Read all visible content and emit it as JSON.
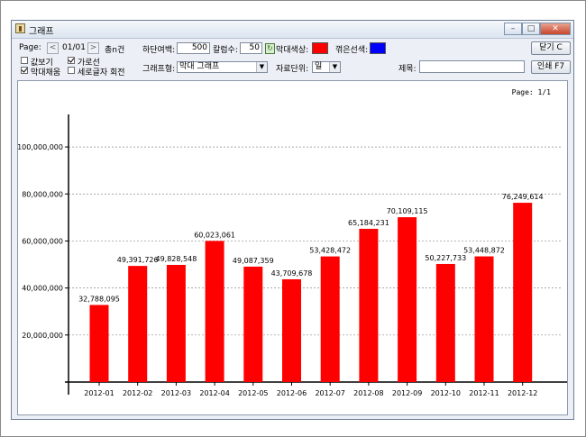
{
  "window": {
    "title": "그래프"
  },
  "toolbar": {
    "page_label": "Page:",
    "page_value": "01/01",
    "total_label": "총n건",
    "bottom_margin_label": "하단여백:",
    "bottom_margin_value": "500",
    "column_count_label": "칼럼수:",
    "column_count_value": "50",
    "bar_color_label": "막대색상:",
    "line_color_label": "꺾은선색:",
    "bar_color": "#ff0000",
    "line_color": "#0000ff",
    "close_label": "닫기 C",
    "print_label": "인쇄 F7",
    "checkbox_value": {
      "label": "값보기",
      "checked": false
    },
    "checkbox_gridline": {
      "label": "가로선",
      "checked": true
    },
    "checkbox_barfill": {
      "label": "막대채움",
      "checked": true
    },
    "checkbox_vertical_text": {
      "label": "세로글자 회전",
      "checked": false
    },
    "graph_type_label": "그래프형:",
    "graph_type_value": "막대 그래프",
    "data_unit_label": "자료단위:",
    "data_unit_value": "일",
    "title_label": "제목:",
    "title_value": ""
  },
  "chart_page": "Page: 1/1",
  "chart_data": {
    "type": "bar",
    "categories": [
      "2012-01",
      "2012-02",
      "2012-03",
      "2012-04",
      "2012-05",
      "2012-06",
      "2012-07",
      "2012-08",
      "2012-09",
      "2012-10",
      "2012-11",
      "2012-12"
    ],
    "values": [
      32788095,
      49391726,
      49828548,
      60023061,
      49087359,
      43709678,
      53428472,
      65184231,
      70109115,
      50227733,
      53448872,
      76249614
    ],
    "value_labels": [
      "32,788,095",
      "49,391,726",
      "49,828,548",
      "60,023,061",
      "49,087,359",
      "43,709,678",
      "53,428,472",
      "65,184,231",
      "70,109,115",
      "50,227,733",
      "53,448,872",
      "76,249,614"
    ],
    "yticks": [
      20000000,
      40000000,
      60000000,
      80000000,
      100000000
    ],
    "ytick_labels": [
      "20,000,000",
      "40,000,000",
      "60,000,000",
      "80,000,000",
      "100,000,000"
    ],
    "ylim": [
      0,
      110000000
    ],
    "grid": true,
    "bar_color": "#ff0000",
    "title": "",
    "xlabel": "",
    "ylabel": ""
  }
}
